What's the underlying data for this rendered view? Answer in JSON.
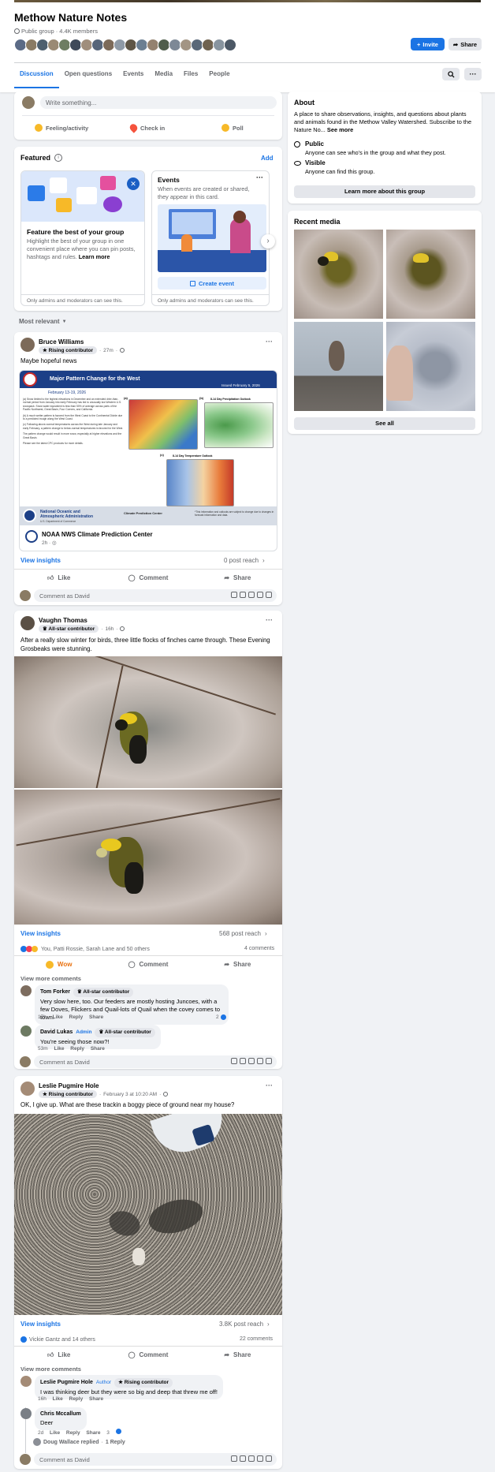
{
  "group": {
    "name": "Methow Nature Notes",
    "privacy": "Public group",
    "members": "4.4K members",
    "invite_label": "Invite",
    "share_label": "Share"
  },
  "tabs": [
    "Discussion",
    "Open questions",
    "Events",
    "Media",
    "Files",
    "People"
  ],
  "composer": {
    "placeholder": "Write something...",
    "actions": [
      "Feeling/activity",
      "Check in",
      "Poll"
    ]
  },
  "featured": {
    "title": "Featured",
    "add_label": "Add",
    "card1": {
      "title": "Feature the best of your group",
      "text": "Highlight the best of your group in one convenient place where you can pin posts, hashtags and rules.",
      "learn_more": "Learn more",
      "footer": "Only admins and moderators can see this."
    },
    "card2": {
      "title": "Events",
      "text": "When events are created or shared, they appear in this card.",
      "button": "Create event",
      "footer": "Only admins and moderators can see this."
    }
  },
  "sort_label": "Most relevant",
  "about": {
    "title": "About",
    "text": "A place to share observations, insights, and questions about plants and animals found in the Methow Valley Watershed. Subscribe to the Nature No...",
    "see_more": "See more",
    "public_title": "Public",
    "public_text": "Anyone can see who's in the group and what they post.",
    "visible_title": "Visible",
    "visible_text": "Anyone can find this group.",
    "learn_more_button": "Learn more about this group"
  },
  "recent_media": {
    "title": "Recent media",
    "see_all": "See all"
  },
  "post1": {
    "author": "Bruce Williams",
    "badge": "Rising contributor",
    "time": "27m",
    "text": "Maybe hopeful news",
    "noaa": {
      "banner_title": "Major Pattern Change for the West",
      "issued": "Issued February 5, 2026",
      "dates": "February 13-19, 2026",
      "map_a_label": "(a)",
      "map_b_label": "(b)",
      "map_c_label": "(c)",
      "map_b_title": "8-14 Day Precipitation Outlook",
      "map_c_title": "8-14 Day Temperature Outlook",
      "paragraph1": "(a) Snow limited to the highest elevations in December and an extended drier-than-normal period from January into early February has led to unusually low Western U.S. snowpack. Snow water equivalent is less than 50% of average across parts of the Pacific Northwest, Great Basin, Four Corners, and California.",
      "paragraph2": "(b) A much wetter pattern is favored from the West Coast to the Continental Divide due to a predicted trough along the West Coast.",
      "paragraph3": "(c) Following above-normal temperatures across the West during late January and early February, a pattern change to below-normal temperatures is favored for the West.",
      "paragraph4": "The pattern change would result in more snow, especially at higher elevations and the Great Basin.",
      "paragraph5": "Please see the latest CPC products for more details.",
      "org1": "National Oceanic and",
      "org2": "Atmospheric Administration",
      "org3": "U.S. Department of Commerce",
      "cpc": "Climate Prediction Center",
      "disclaimer": "*This information and outlooks are subject to change due to changes in forecast information and data."
    },
    "page_name": "NOAA NWS Climate Prediction Center",
    "page_time": "2h",
    "insights": "View insights",
    "reach": "0 post reach",
    "like": "Like",
    "comment": "Comment",
    "share": "Share",
    "comment_as": "Comment as David"
  },
  "post2": {
    "author": "Vaughn Thomas",
    "badge": "All-star contributor",
    "time": "16h",
    "text": "After a really slow winter for birds, three little flocks of finches came through. These Evening Grosbeaks were stunning.",
    "insights": "View insights",
    "reach": "568 post reach",
    "reactions_text": "You, Patti Rossie, Sarah Lane and 50 others",
    "comments_count": "4 comments",
    "wow": "Wow",
    "comment": "Comment",
    "share": "Share",
    "view_more": "View more comments",
    "comments": [
      {
        "author": "Tom Forker",
        "badge": "All-star contributor",
        "text": "Very slow here, too. Our feeders are mostly hosting Juncoes, with a few Doves, Flickers and Quail-lots of Quail when the covey comes to town.",
        "time": "17h",
        "like": "Like",
        "reply": "Reply",
        "share": "Share",
        "count": "2"
      },
      {
        "author": "David Lukas",
        "role": "Admin",
        "badge": "All-star contributor",
        "text": "You're seeing those now?!",
        "time": "53m",
        "like": "Like",
        "reply": "Reply",
        "share": "Share"
      }
    ],
    "comment_as": "Comment as David"
  },
  "post3": {
    "author": "Leslie Pugmire Hole",
    "badge": "Rising contributor",
    "time": "February 3 at 10:20 AM",
    "text": "OK, I give up. What are these trackin  a boggy piece of ground near my house?",
    "insights": "View insights",
    "reach": "3.8K post reach",
    "reactions_text": "Vickie Gantz and 14 others",
    "comments_count": "22 comments",
    "like": "Like",
    "comment": "Comment",
    "share": "Share",
    "view_more": "View more comments",
    "comments": [
      {
        "author": "Leslie Pugmire Hole",
        "role": "Author",
        "badge": "Rising contributor",
        "text": "I was thinking deer but they were so big and deep that threw me off!",
        "time": "16h",
        "like": "Like",
        "reply": "Reply",
        "share": "Share"
      },
      {
        "author": "Chris Mccallum",
        "text": "Deer",
        "time": "2d",
        "like": "Like",
        "reply": "Reply",
        "share": "Share",
        "count": "3"
      }
    ],
    "replied": "Doug Wallace replied",
    "replies": "1 Reply",
    "comment_as": "Comment as David"
  },
  "colors": {
    "accent": "#1b74e4",
    "background": "#f0f2f5"
  }
}
